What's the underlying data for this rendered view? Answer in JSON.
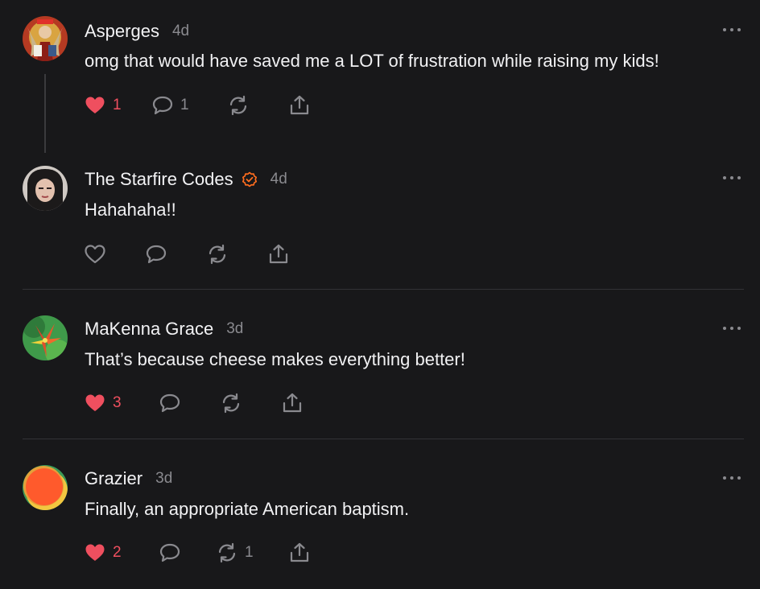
{
  "colors": {
    "background": "#18181a",
    "text": "#f1f1f3",
    "muted": "#8a8a8f",
    "like": "#ef4f5f",
    "verified": "#ff6d1f"
  },
  "comments": [
    {
      "author": "Asperges",
      "time": "4d",
      "text": "omg that would have saved me a LOT of frustration while raising my kids!",
      "liked": true,
      "likes": "1",
      "replies": "1",
      "restacks": "",
      "verified": false,
      "avatar_icon": "angel-painting-avatar"
    },
    {
      "author": "The Starfire Codes",
      "time": "4d",
      "text": "Hahahaha!!",
      "liked": false,
      "likes": "",
      "replies": "",
      "restacks": "",
      "verified": true,
      "avatar_icon": "portrait-photo-avatar"
    },
    {
      "author": "MaKenna Grace",
      "time": "3d",
      "text": "That’s because cheese makes everything better!",
      "liked": true,
      "likes": "3",
      "replies": "",
      "restacks": "",
      "verified": false,
      "avatar_icon": "lily-flower-avatar"
    },
    {
      "author": "Grazier",
      "time": "3d",
      "text": "Finally, an appropriate American baptism.",
      "liked": true,
      "likes": "2",
      "replies": "",
      "restacks": "1",
      "verified": false,
      "avatar_icon": "orange-circle-avatar"
    }
  ]
}
